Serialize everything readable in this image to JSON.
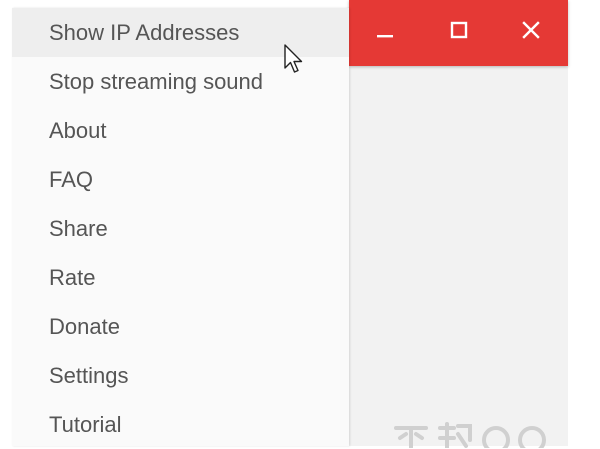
{
  "menu": {
    "items": [
      {
        "label": "Show IP Addresses",
        "hovered": true
      },
      {
        "label": "Stop streaming sound"
      },
      {
        "label": "About"
      },
      {
        "label": "FAQ"
      },
      {
        "label": "Share"
      },
      {
        "label": "Rate"
      },
      {
        "label": "Donate"
      },
      {
        "label": "Settings"
      },
      {
        "label": "Tutorial"
      }
    ]
  },
  "titlebar": {
    "color": "#e53935",
    "buttons": [
      {
        "icon": "minimize-icon"
      },
      {
        "icon": "maximize-icon"
      },
      {
        "icon": "close-icon"
      }
    ]
  },
  "colors": {
    "menu_text": "#555555",
    "menu_background": "#fafafa",
    "hover_background": "#eeeeee",
    "window_background": "#f2f2f2"
  }
}
